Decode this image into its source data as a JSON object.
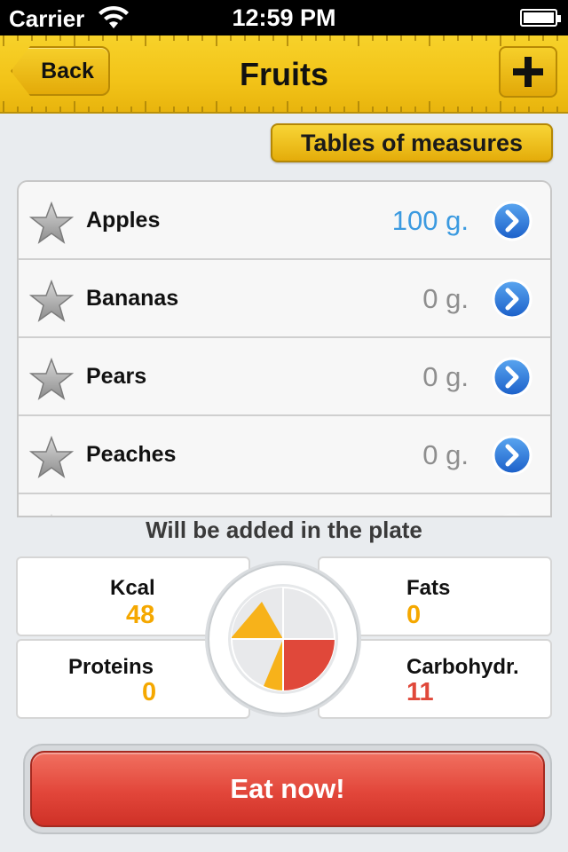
{
  "status_bar": {
    "carrier": "Carrier",
    "time": "12:59 PM"
  },
  "nav": {
    "back_label": "Back",
    "title": "Fruits",
    "add_icon": "plus-icon"
  },
  "measures_button": "Tables of measures",
  "items": [
    {
      "name": "Apples",
      "amount": "100 g.",
      "active": true
    },
    {
      "name": "Bananas",
      "amount": "0 g.",
      "active": false
    },
    {
      "name": "Pears",
      "amount": "0 g.",
      "active": false
    },
    {
      "name": "Peaches",
      "amount": "0 g.",
      "active": false
    }
  ],
  "summary": {
    "title": "Will be added in the plate",
    "kcal_label": "Kcal",
    "kcal_value": "48",
    "fats_label": "Fats",
    "fats_value": "0",
    "proteins_label": "Proteins",
    "proteins_value": "0",
    "carbs_label": "Carbohydr.",
    "carbs_value": "11"
  },
  "eat_button": "Eat now!",
  "colors": {
    "accent_yellow": "#f2c318",
    "orange_value": "#f5a800",
    "red_value": "#e0483a",
    "blue_active": "#3b9ae0",
    "eat_red": "#e2463a"
  }
}
